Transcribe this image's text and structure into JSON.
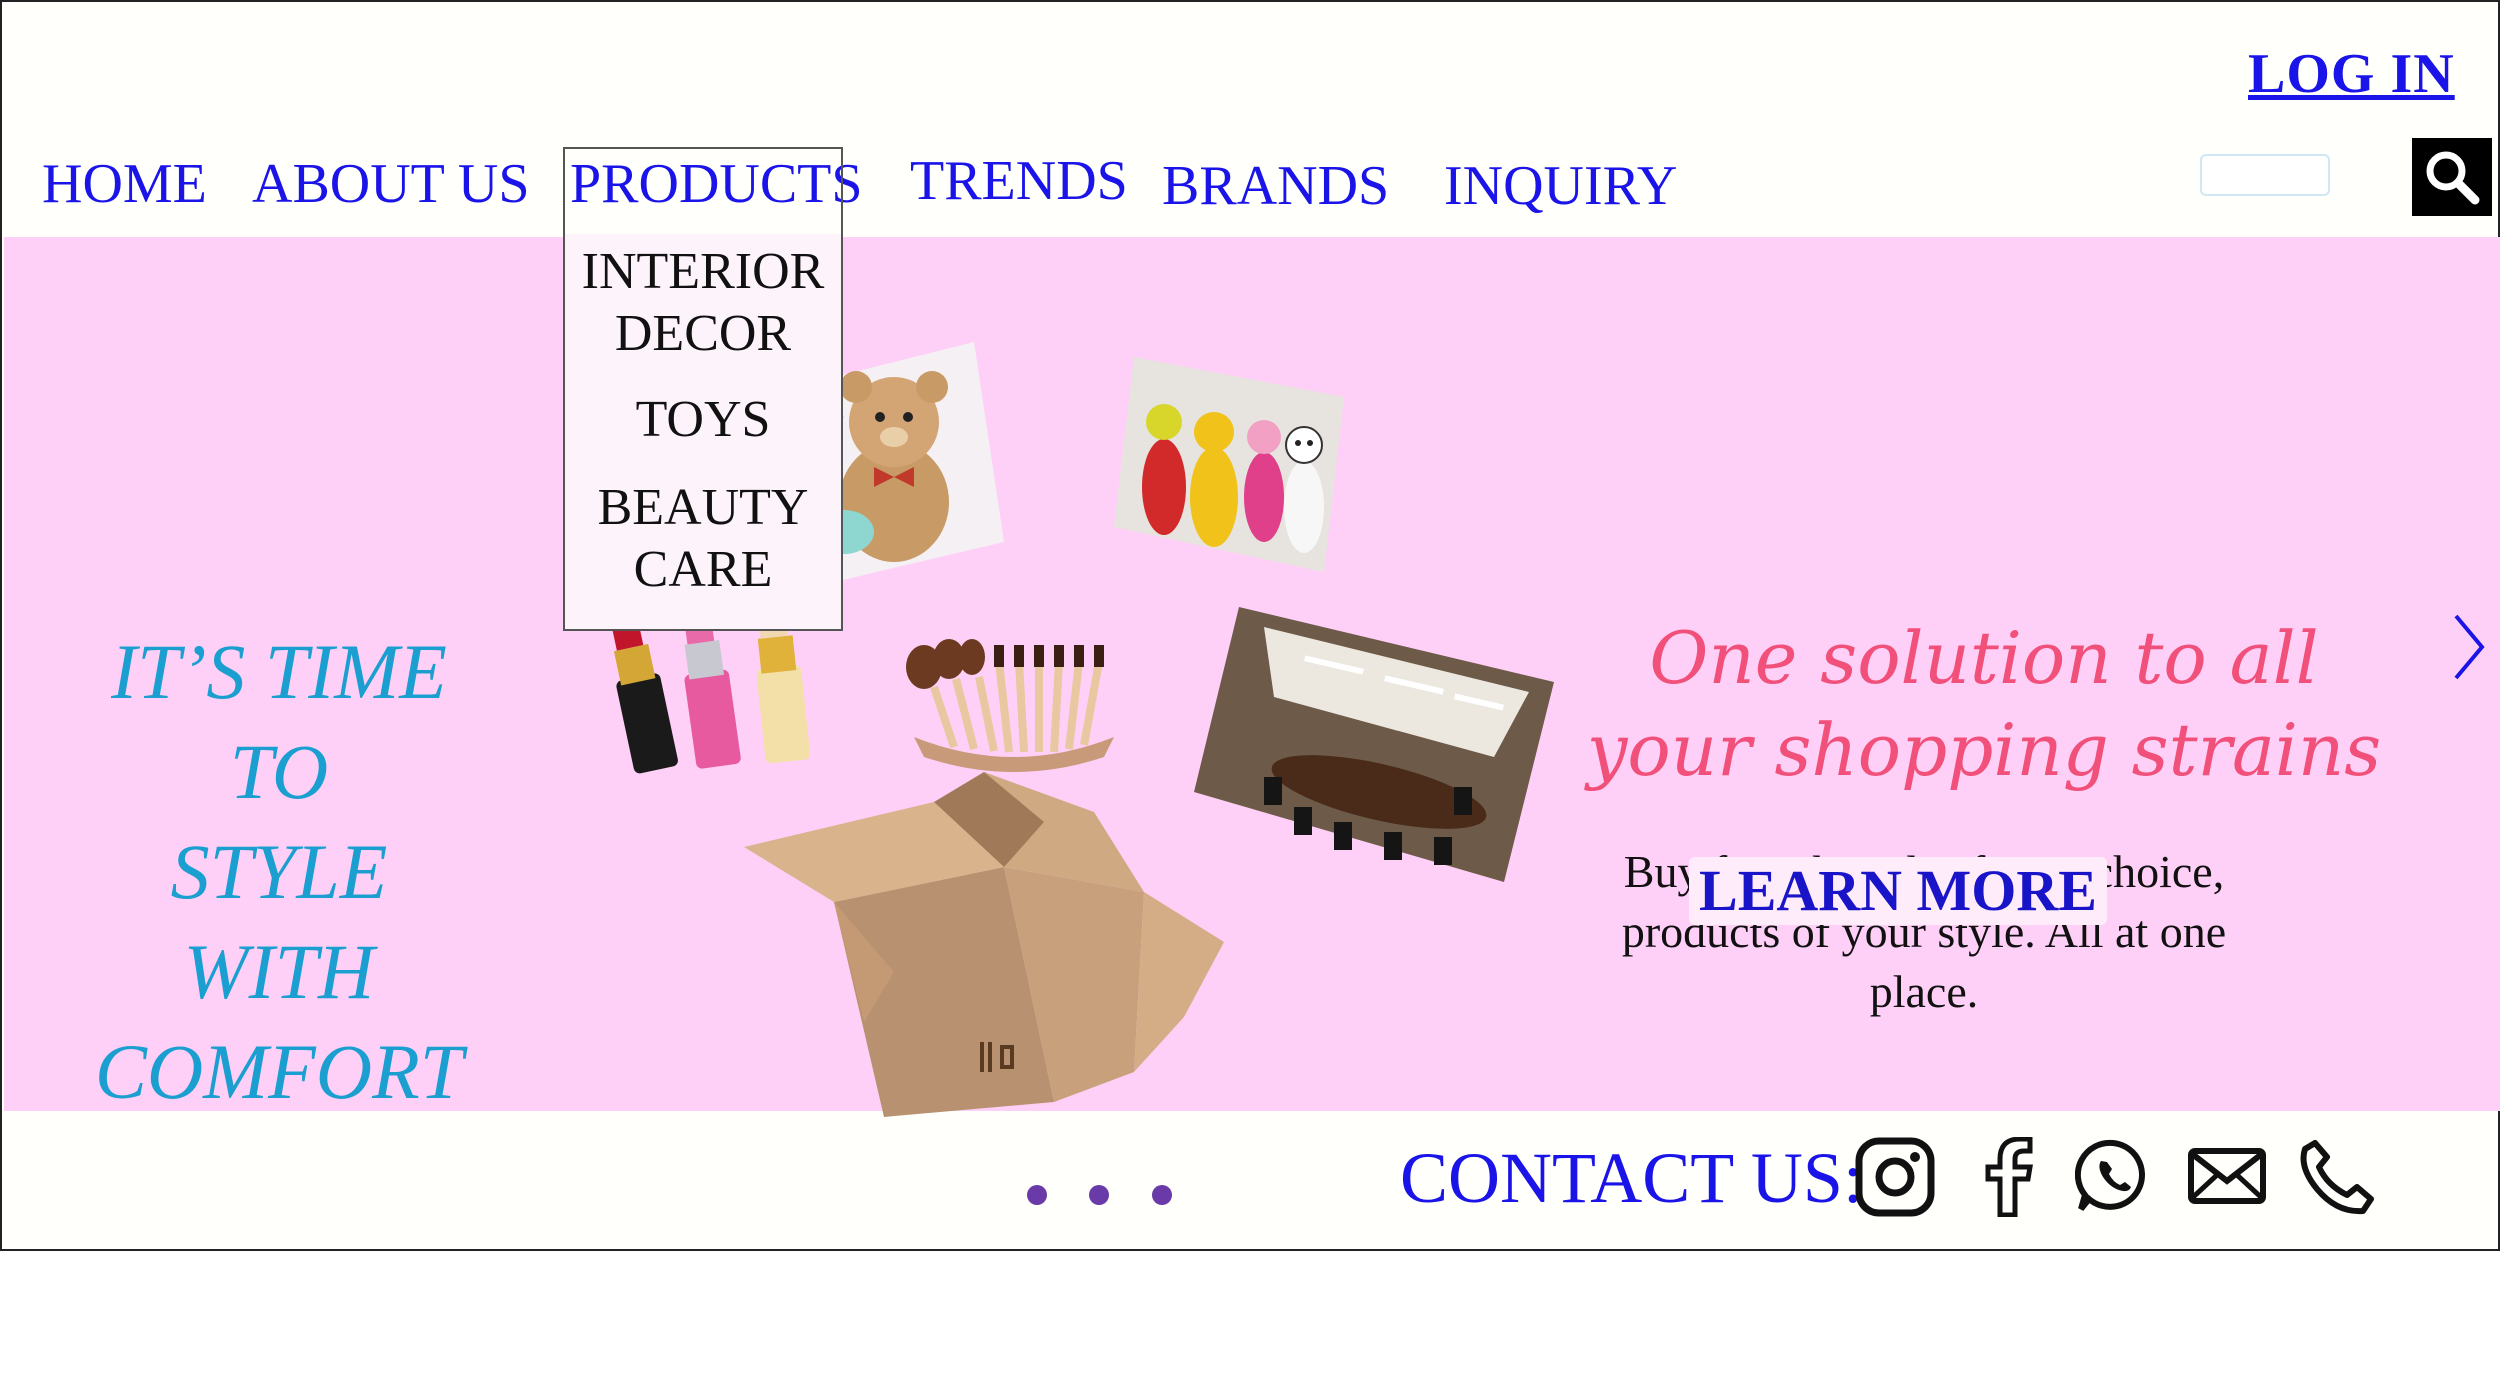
{
  "header": {
    "login_label": "LOG IN",
    "nav": [
      {
        "label": "HOME"
      },
      {
        "label": "ABOUT US"
      },
      {
        "label": "PRODUCTS"
      },
      {
        "label": "TRENDS"
      },
      {
        "label": "BRANDS"
      },
      {
        "label": "INQUIRY"
      }
    ],
    "products_dropdown": [
      {
        "line1": "INTERIOR",
        "line2": "DECOR"
      },
      {
        "line1": "TOYS",
        "line2": ""
      },
      {
        "line1": "BEAUTY",
        "line2": "CARE"
      }
    ],
    "search": {
      "placeholder": "",
      "icon": "search-icon"
    }
  },
  "hero": {
    "tagline_lines": [
      "IT’S TIME",
      "TO",
      "STYLE",
      "WITH",
      "COMFORT"
    ],
    "headline_lines": [
      "One solution to all",
      "your shopping strains"
    ],
    "description_lines": [
      "Buy from brands of your choice,",
      "products of your style. All at one",
      "place."
    ],
    "cta_label": "LEARN MORE",
    "next_icon": "chevron-right-icon",
    "images": [
      "teddy-bear",
      "bowling-pins-toy",
      "lipsticks",
      "makeup-brushes",
      "conference-room",
      "cardboard-box"
    ]
  },
  "footer": {
    "contact_label": "CONTACT US:",
    "carousel_dots": 3,
    "social_icons": [
      "instagram-icon",
      "facebook-icon",
      "whatsapp-icon",
      "mail-icon",
      "phone-icon"
    ]
  },
  "colors": {
    "nav_text": "#1a14e8",
    "hero_bg": "#ffd0f7",
    "tagline": "#1a9fd0",
    "headline": "#f0507a",
    "dots": "#6a3aa8"
  }
}
